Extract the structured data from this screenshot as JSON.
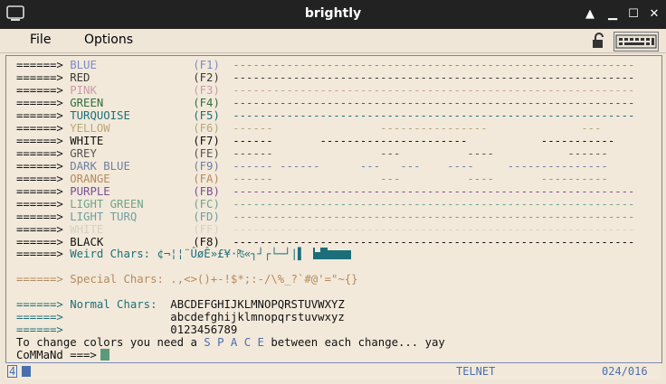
{
  "window": {
    "title": "brightly"
  },
  "menu": {
    "file": "File",
    "options": "Options"
  },
  "colors": {
    "blue": "#7a8bc4",
    "red": "#3a3a3a",
    "pink": "#c99ca8",
    "green": "#2e6e3c",
    "turquoise": "#1c6f7a",
    "yellow": "#b7a77a",
    "white": "#111111",
    "grey": "#555555",
    "darkblue": "#6e7ea6",
    "orange": "#b58a5e",
    "purple": "#7a4d95",
    "lightgreen": "#6fa58a",
    "lightturq": "#6e9fa2",
    "faint": "#d8d0c2",
    "black": "#111111",
    "accent": "#4a6fb1"
  },
  "rows": [
    {
      "arrow": "======>",
      "name": "BLUE",
      "code": "(F1)",
      "pattern": "------------------------------------------------------------"
    },
    {
      "arrow": "======>",
      "name": "RED",
      "code": "(F2)",
      "pattern": "------------------------------------------------------------"
    },
    {
      "arrow": "======>",
      "name": "PINK",
      "code": "(F3)",
      "pattern": "------------------------------------------------------------"
    },
    {
      "arrow": "======>",
      "name": "GREEN",
      "code": "(F4)",
      "pattern": "------------------------------------------------------------"
    },
    {
      "arrow": "======>",
      "name": "TURQUOISE",
      "code": "(F5)",
      "pattern": "------------------------------------------------------------"
    },
    {
      "arrow": "======>",
      "name": "YELLOW",
      "code": "(F6)",
      "pattern": "------                ----------------              ---"
    },
    {
      "arrow": "======>",
      "name": "WHITE",
      "code": "(F7)",
      "pattern": "------       ----------------------           -----------"
    },
    {
      "arrow": "======>",
      "name": "GREY",
      "code": "(FE)",
      "pattern": "------                ---          ----           ------"
    },
    {
      "arrow": "======>",
      "name": "DARK BLUE",
      "code": "(F9)",
      "pattern": "------ ------      ---   ---    ----     ---------------"
    },
    {
      "arrow": "======>",
      "name": "ORANGE",
      "code": "(FA)",
      "pattern": "------                ---          ----       ----------"
    },
    {
      "arrow": "======>",
      "name": "PURPLE",
      "code": "(FB)",
      "pattern": "------------------------------------------------------------"
    },
    {
      "arrow": "======>",
      "name": "LIGHT GREEN",
      "code": "(FC)",
      "pattern": "------------------------------------------------------------"
    },
    {
      "arrow": "======>",
      "name": "LIGHT TURQ",
      "code": "(FD)",
      "pattern": "------------------------------------------------------------"
    },
    {
      "arrow": "======>",
      "name": "WHITE",
      "code": "(FF)",
      "pattern": "------------------------------------------------------------"
    },
    {
      "arrow": "======>",
      "name": "BLACK",
      "code": "(F8)",
      "pattern": "------------------------------------------------------------"
    }
  ],
  "weird": {
    "arrow": "======>",
    "label": "Weird Chars:",
    "chars": "¢¬¦¦¨ÛøÊ»£¥·₧«┐┘┌└─┘|▌ "
  },
  "special": {
    "arrow": "======>",
    "label": "Special Chars:",
    "chars": ".,<>()+-!$*;:-/\\%_?`#@'=\"~{}"
  },
  "normal": {
    "arrow": "======>",
    "label": "Normal Chars:",
    "upper": "ABCDEFGHIJKLMNOPQRSTUVWXYZ",
    "lower": "abcdefghijklmnopqrstuvwxyz",
    "digits": "0123456789"
  },
  "message": {
    "prefix": "To change colors you need a ",
    "space": "S P A C E",
    "suffix": " between each change... yay"
  },
  "prompt": "CoMMaNd ===>",
  "status": {
    "left": "4",
    "protocol": "TELNET",
    "position": "024/016"
  }
}
